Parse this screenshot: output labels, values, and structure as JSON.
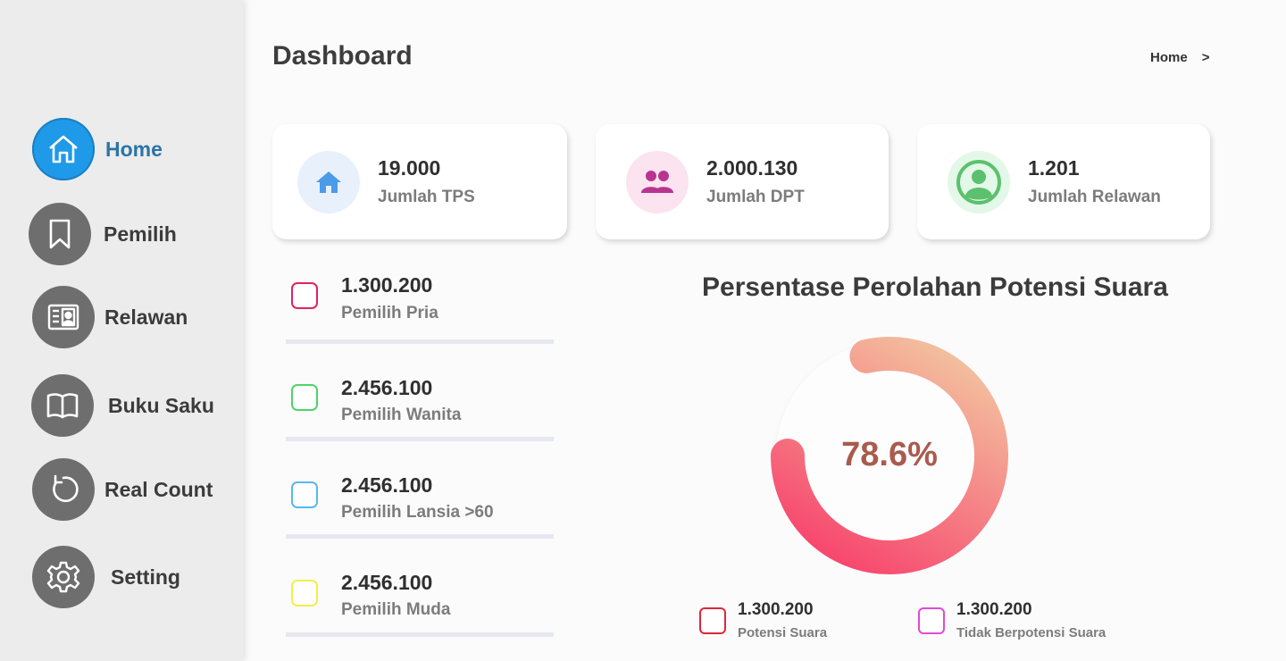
{
  "header": {
    "title": "Dashboard",
    "breadcrumb_home": "Home",
    "breadcrumb_sep": ">"
  },
  "sidebar": {
    "items": [
      {
        "label": "Home",
        "icon": "home-icon"
      },
      {
        "label": "Pemilih",
        "icon": "bookmark-icon"
      },
      {
        "label": "Relawan",
        "icon": "id-card-icon"
      },
      {
        "label": "Buku Saku",
        "icon": "book-icon"
      },
      {
        "label": "Real Count",
        "icon": "refresh-icon"
      },
      {
        "label": "Setting",
        "icon": "gear-icon"
      }
    ]
  },
  "stats": [
    {
      "value": "19.000",
      "label": "Jumlah TPS",
      "icon": "house-icon",
      "color": "#4b9be8"
    },
    {
      "value": "2.000.130",
      "label": "Jumlah DPT",
      "icon": "users-icon",
      "color": "#b8358f"
    },
    {
      "value": "1.201",
      "label": "Jumlah Relawan",
      "icon": "user-circle-icon",
      "color": "#5cc06e"
    }
  ],
  "voters": [
    {
      "value": "1.300.200",
      "label": "Pemilih Pria",
      "color": "#e0245e"
    },
    {
      "value": "2.456.100",
      "label": "Pemilih Wanita",
      "color": "#4fd36a"
    },
    {
      "value": "2.456.100",
      "label": "Pemilih Lansia >60",
      "color": "#5ab8ee"
    },
    {
      "value": "2.456.100",
      "label": "Pemilih Muda",
      "color": "#f1ef4a"
    }
  ],
  "chart": {
    "title": "Persentase Perolahan Potensi Suara",
    "percent_label": "78.6%",
    "percent": 78.6,
    "colors": {
      "start": "#f7476e",
      "end": "#f3bf9e"
    }
  },
  "legend": [
    {
      "value": "1.300.200",
      "label": "Potensi Suara",
      "color": "#e0253a"
    },
    {
      "value": "1.300.200",
      "label": "Tidak Berpotensi Suara",
      "color": "#e04ad6"
    }
  ]
}
